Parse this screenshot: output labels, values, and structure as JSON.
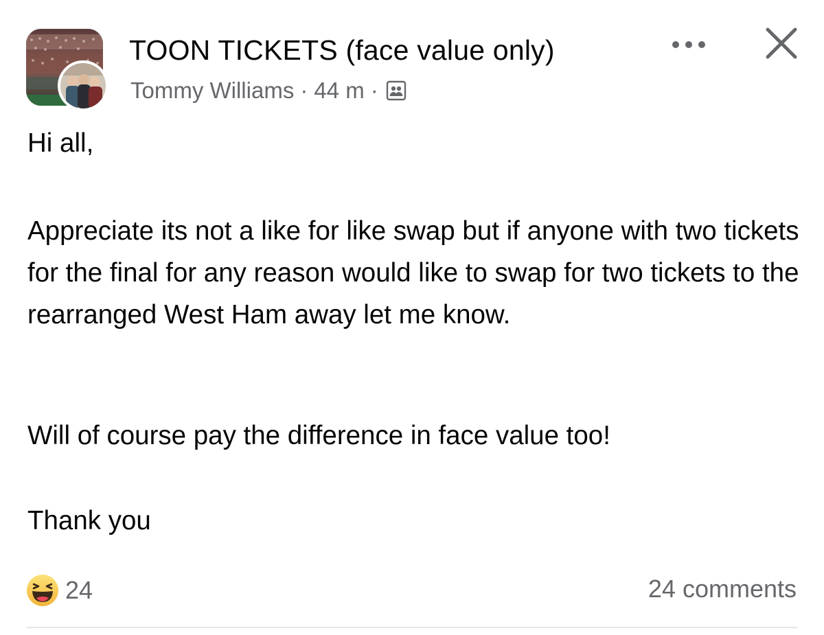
{
  "header": {
    "group_name": "TOON TICKETS (face value only)",
    "author": "Tommy Williams",
    "separator": "·",
    "time": "44 m",
    "audience_icon": "members-icon",
    "more_icon": "more-horizontal-icon",
    "close_icon": "close-icon"
  },
  "post": {
    "greeting": "Hi all,",
    "paragraph_1": "Appreciate its not a like for like swap but if anyone with two tickets for the final for any reason  would like to swap for two tickets to the rearranged West Ham away let me know.",
    "paragraph_2": "Will of course pay the difference in face value too!",
    "paragraph_3": "Thank you"
  },
  "footer": {
    "reaction_icon": "haha-emoji-icon",
    "reaction_count": "24",
    "comments_label": "24 comments"
  },
  "colors": {
    "text_primary": "#050505",
    "text_secondary": "#65676b",
    "divider": "#e4e6eb",
    "reaction_yellow": "#f7c242"
  }
}
